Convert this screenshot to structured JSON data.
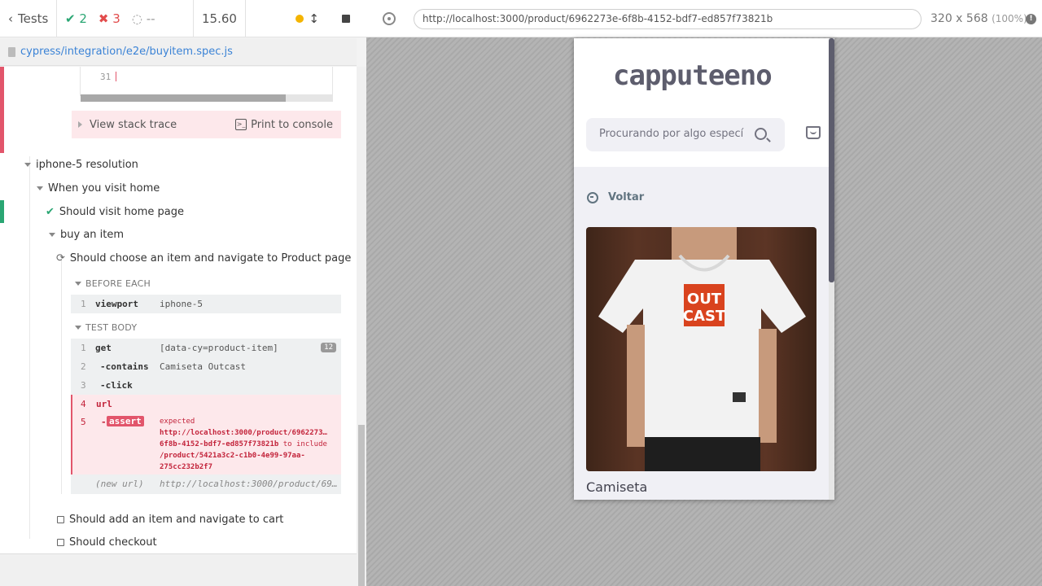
{
  "reporter": {
    "tests_label": "Tests",
    "passed": "2",
    "failed": "3",
    "pending": "--",
    "duration": "15.60",
    "spec_path": "cypress/integration/e2e/buyitem.spec.js"
  },
  "error_panel": {
    "code_line_num": "31",
    "stack_label": "View stack trace",
    "print_label": "Print to console"
  },
  "tree": {
    "suite": "iphone-5 resolution",
    "context": "When you visit home",
    "test_pass": "Should visit home page",
    "sub_suite": "buy an item",
    "test_running": "Should choose an item and navigate to Product page",
    "before_each_label": "BEFORE EACH",
    "test_body_label": "TEST BODY",
    "test_add": "Should add an item and navigate to cart",
    "test_checkout": "Should checkout"
  },
  "before_each": [
    {
      "num": "1",
      "name": "viewport",
      "msg": "iphone-5"
    }
  ],
  "commands": [
    {
      "num": "1",
      "name": "get",
      "msg": "[data-cy=product-item]",
      "badge": "12"
    },
    {
      "num": "2",
      "name": "-contains",
      "msg": "Camiseta Outcast"
    },
    {
      "num": "3",
      "name": "-click",
      "msg": ""
    }
  ],
  "failed_cmd": {
    "url_num": "4",
    "url_name": "url",
    "assert_num": "5",
    "assert_prefix": "-",
    "assert_name": "assert",
    "expected_label": "expected",
    "actual_url_1": "http://localhost:3000/product/6962273…",
    "actual_url_2": "6f8b-4152-bdf7-ed857f73821b",
    "include_text": "to include",
    "expected_path_1": "/product/5421a3c2-c1b0-4e99-97aa-",
    "expected_path_2": "275cc232b2f7"
  },
  "new_url": {
    "name": "(new url)",
    "msg": "http://localhost:3000/product/69…"
  },
  "aut": {
    "url": "http://localhost:3000/product/6962273e-6f8b-4152-bdf7-ed857f73821b",
    "viewport_size": "320 x 568",
    "viewport_scale": "(100%)"
  },
  "app": {
    "logo": "capputeeno",
    "search_placeholder": "Procurando por algo especí",
    "back_label": "Voltar",
    "product_name": "Camiseta",
    "shirt_print_1": "OUT",
    "shirt_print_2": "CAST"
  },
  "colors": {
    "pass": "#2aa673",
    "fail": "#e24c4c",
    "link": "#3b83d6",
    "accent": "#e2556b"
  }
}
